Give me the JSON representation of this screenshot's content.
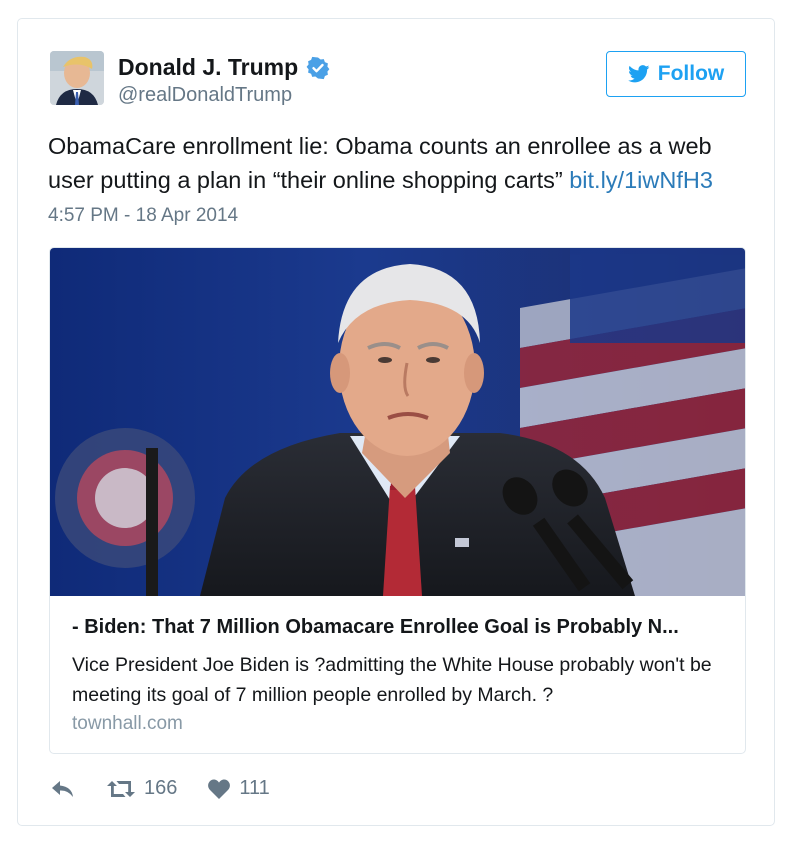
{
  "user": {
    "display_name": "Donald J. Trump",
    "handle": "@realDonaldTrump",
    "verified_icon": "verified-badge-icon",
    "avatar_icon": "avatar"
  },
  "follow_button": {
    "label": "Follow",
    "icon": "twitter-bird-icon"
  },
  "tweet": {
    "text": "ObamaCare enrollment lie: Obama counts an enrollee as a web user putting a plan in “their online shopping carts”",
    "link": "bit.ly/1iwNfH3",
    "timestamp": "4:57 PM - 18 Apr 2014"
  },
  "card": {
    "title": "- Biden: That 7 Million Obamacare Enrollee Goal is Probably N...",
    "description": "Vice President Joe Biden is ?admitting the White House probably won't be meeting its goal of 7 million people enrolled by March. ?",
    "domain": "townhall.com"
  },
  "actions": {
    "reply_icon": "reply-icon",
    "retweet_icon": "retweet-icon",
    "retweet_count": "166",
    "like_icon": "heart-icon",
    "like_count": "111"
  },
  "colors": {
    "accent": "#1da1f2",
    "link": "#2b7bb9",
    "muted": "#657786",
    "border": "#e1e8ed"
  }
}
